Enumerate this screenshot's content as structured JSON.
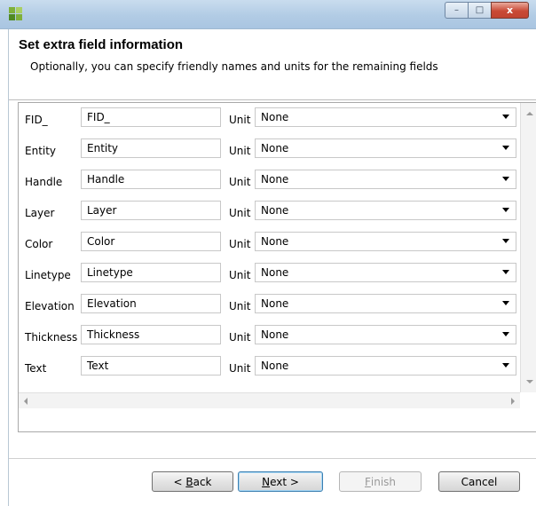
{
  "window": {
    "controls": {
      "minimize": "–",
      "maximize": "□",
      "close": "x"
    }
  },
  "header": {
    "title": "Set extra field information",
    "description": "Optionally, you can specify friendly names and units for the remaining fields"
  },
  "fields": [
    {
      "name": "FID_",
      "value": "FID_",
      "unit_label": "Unit",
      "unit": "None"
    },
    {
      "name": "Entity",
      "value": "Entity",
      "unit_label": "Unit",
      "unit": "None"
    },
    {
      "name": "Handle",
      "value": "Handle",
      "unit_label": "Unit",
      "unit": "None"
    },
    {
      "name": "Layer",
      "value": "Layer",
      "unit_label": "Unit",
      "unit": "None"
    },
    {
      "name": "Color",
      "value": "Color",
      "unit_label": "Unit",
      "unit": "None"
    },
    {
      "name": "Linetype",
      "value": "Linetype",
      "unit_label": "Unit",
      "unit": "None"
    },
    {
      "name": "Elevation",
      "value": "Elevation",
      "unit_label": "Unit",
      "unit": "None"
    },
    {
      "name": "Thickness",
      "value": "Thickness",
      "unit_label": "Unit",
      "unit": "None"
    },
    {
      "name": "Text",
      "value": "Text",
      "unit_label": "Unit",
      "unit": "None"
    }
  ],
  "buttons": {
    "back": {
      "prefix": "< ",
      "mnemonic": "B",
      "rest": "ack"
    },
    "next": {
      "mnemonic": "N",
      "rest": "ext >"
    },
    "finish": {
      "mnemonic": "F",
      "rest": "inish"
    },
    "cancel": "Cancel"
  },
  "colors": {
    "titlebar": "#b2cce5",
    "close_button": "#c94a36",
    "default_button_border": "#3c7fb1"
  }
}
